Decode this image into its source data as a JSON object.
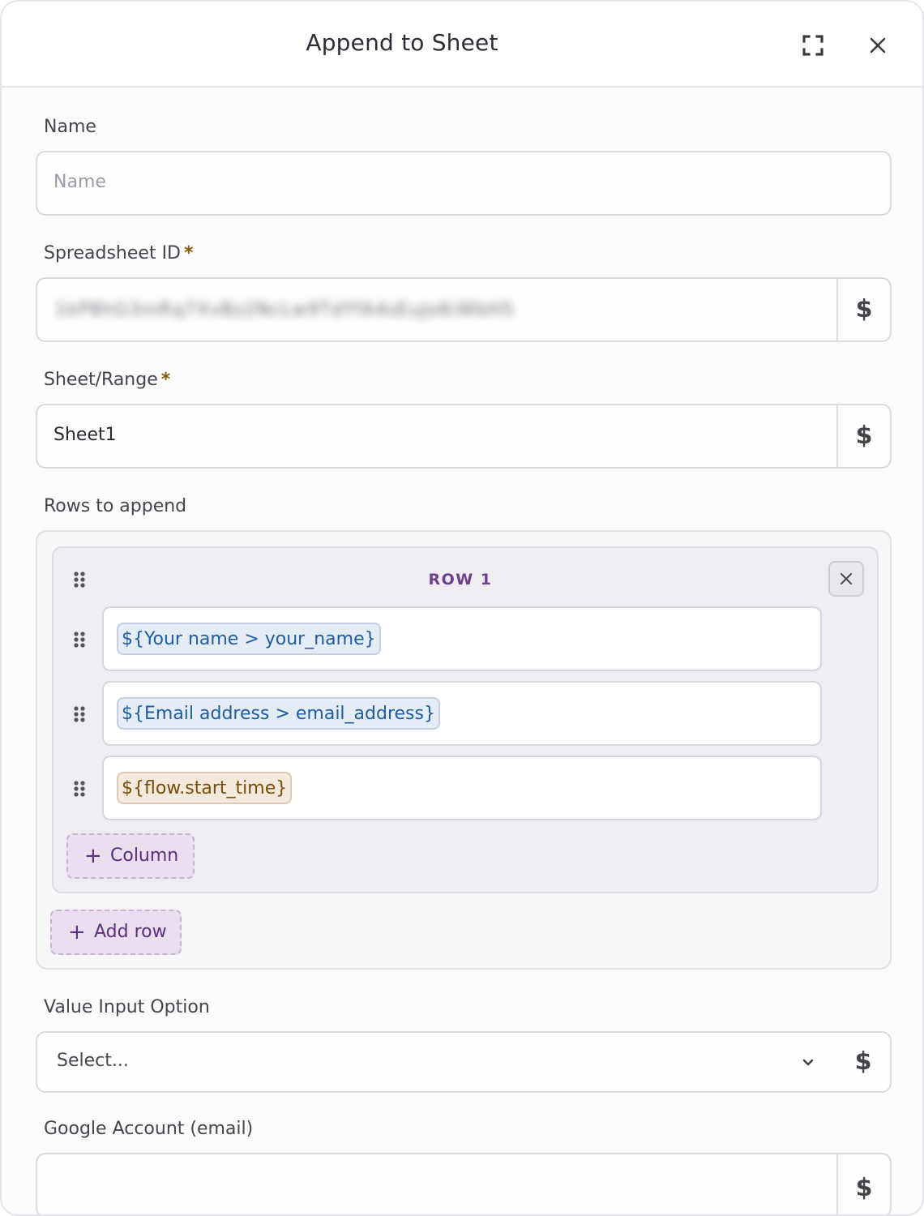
{
  "dialog": {
    "title": "Append to Sheet"
  },
  "fields": {
    "name": {
      "label": "Name",
      "placeholder": "Name"
    },
    "spreadsheet_id": {
      "label": "Spreadsheet ID",
      "required_mark": "*",
      "value": "1kP8hG3mRq7XvBz2NcLw9TdYfA4sEuJo6iWbH5",
      "dollar": "$"
    },
    "sheet_range": {
      "label": "Sheet/Range",
      "required_mark": "*",
      "value": "Sheet1",
      "dollar": "$"
    },
    "rows": {
      "label": "Rows to append",
      "row_title": "ROW 1",
      "columns": [
        {
          "value": "${Your name > your_name}",
          "style": "variable"
        },
        {
          "value": "${Email address > email_address}",
          "style": "variable"
        },
        {
          "value": "${flow.start_time}",
          "style": "flow-variable"
        }
      ],
      "add_column_label": "Column",
      "add_row_label": "Add row",
      "plus": "+"
    },
    "value_input_option": {
      "label": "Value Input Option",
      "selected": "Select...",
      "dollar": "$"
    },
    "google_account": {
      "label": "Google Account (email)",
      "value": "",
      "dollar": "$"
    }
  },
  "colors": {
    "accent": "#6d3f8e",
    "required": "#8a5a00",
    "variable_chip": "#e4ecf6",
    "flow_chip": "#f3e9dc"
  },
  "icons": {
    "expand": "expand-icon",
    "close": "close-icon",
    "drag": "drag-handle-icon",
    "chevron": "chevron-down-icon"
  }
}
